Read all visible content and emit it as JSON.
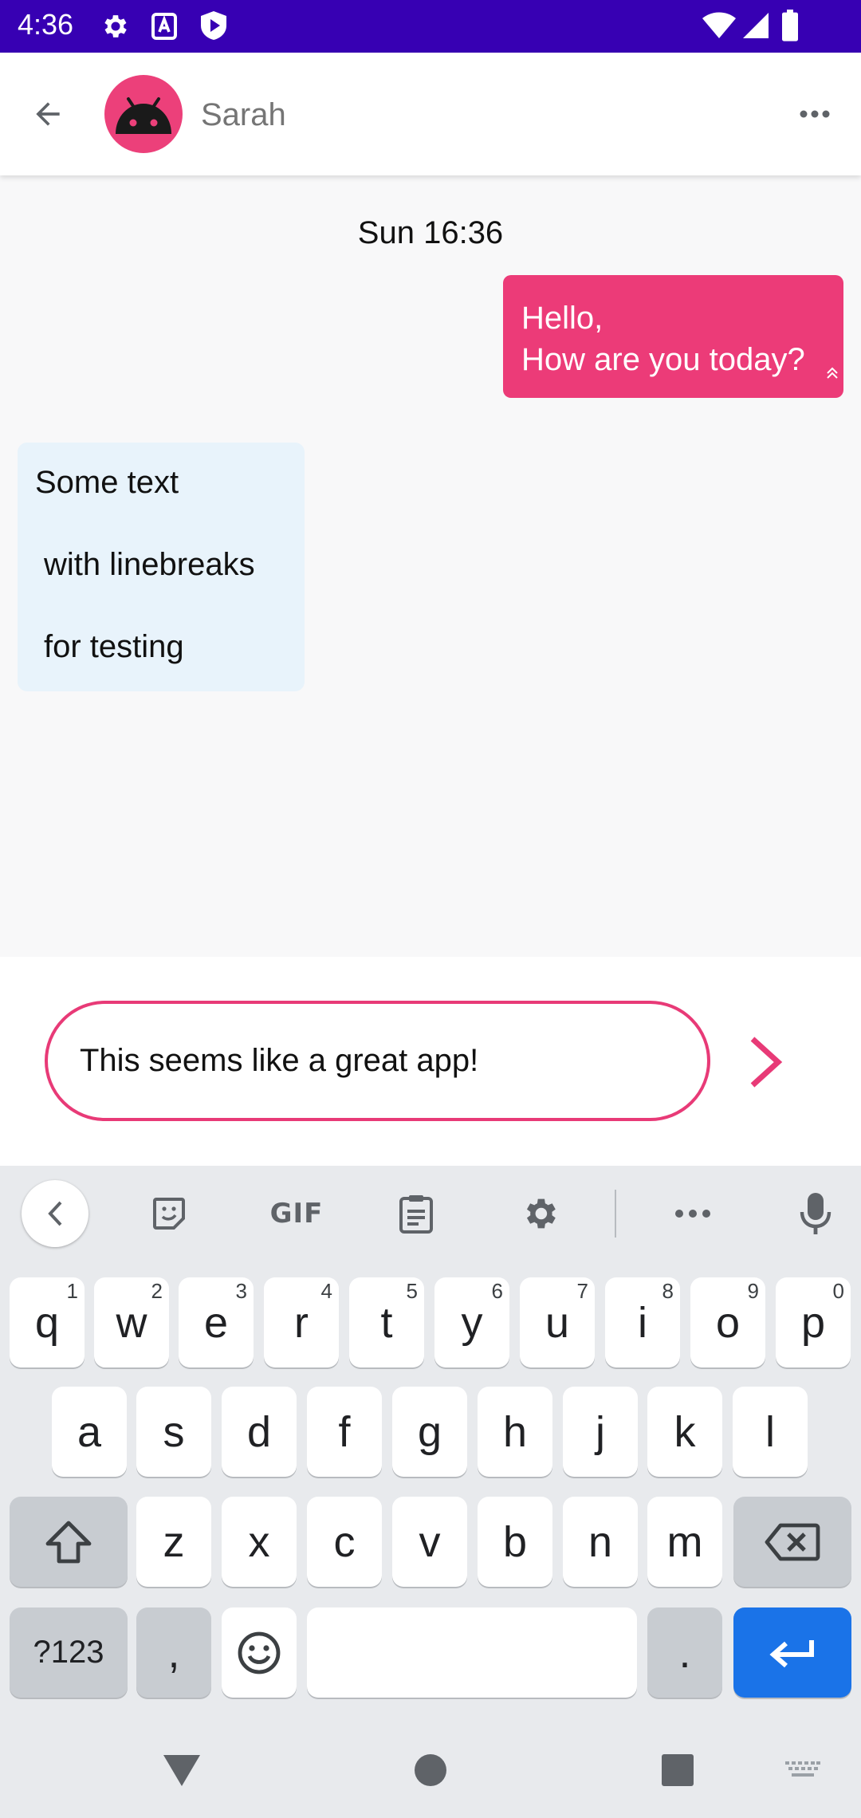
{
  "status_bar": {
    "time": "4:36",
    "icons": [
      "settings-icon",
      "a-icon",
      "play-protect-icon",
      "wifi-icon",
      "signal-icon",
      "battery-icon"
    ]
  },
  "app_bar": {
    "contact_name": "Sarah",
    "back_icon": "arrow-back-icon",
    "more_icon": "more-horizontal-icon"
  },
  "conversation": {
    "date_separator": "Sun 16:36",
    "outgoing": {
      "lines": [
        "Hello,",
        "How are you today?"
      ],
      "status_icon": "double-chevron-up-icon"
    },
    "incoming": {
      "lines": [
        "Some text",
        "with linebreaks",
        "for testing"
      ]
    }
  },
  "composer": {
    "input_value": "This seems like a great app!",
    "send_icon": "chevron-right-icon"
  },
  "keyboard": {
    "toolbar": {
      "gif_label": "GIF",
      "icons": [
        "chevron-left-icon",
        "sticker-icon",
        "gif-icon",
        "clipboard-icon",
        "gear-icon",
        "more-horizontal-icon",
        "mic-icon"
      ]
    },
    "row1": [
      {
        "key": "q",
        "hint": "1"
      },
      {
        "key": "w",
        "hint": "2"
      },
      {
        "key": "e",
        "hint": "3"
      },
      {
        "key": "r",
        "hint": "4"
      },
      {
        "key": "t",
        "hint": "5"
      },
      {
        "key": "y",
        "hint": "6"
      },
      {
        "key": "u",
        "hint": "7"
      },
      {
        "key": "i",
        "hint": "8"
      },
      {
        "key": "o",
        "hint": "9"
      },
      {
        "key": "p",
        "hint": "0"
      }
    ],
    "row2": [
      "a",
      "s",
      "d",
      "f",
      "g",
      "h",
      "j",
      "k",
      "l"
    ],
    "row3": [
      "z",
      "x",
      "c",
      "v",
      "b",
      "n",
      "m"
    ],
    "symbols_label": "?123",
    "comma_label": ",",
    "period_label": "."
  },
  "colors": {
    "status_bar": "#3700b3",
    "accent_pink": "#ec3b78",
    "incoming_bubble": "#e8f3fb",
    "enter_key": "#1a73e8"
  }
}
